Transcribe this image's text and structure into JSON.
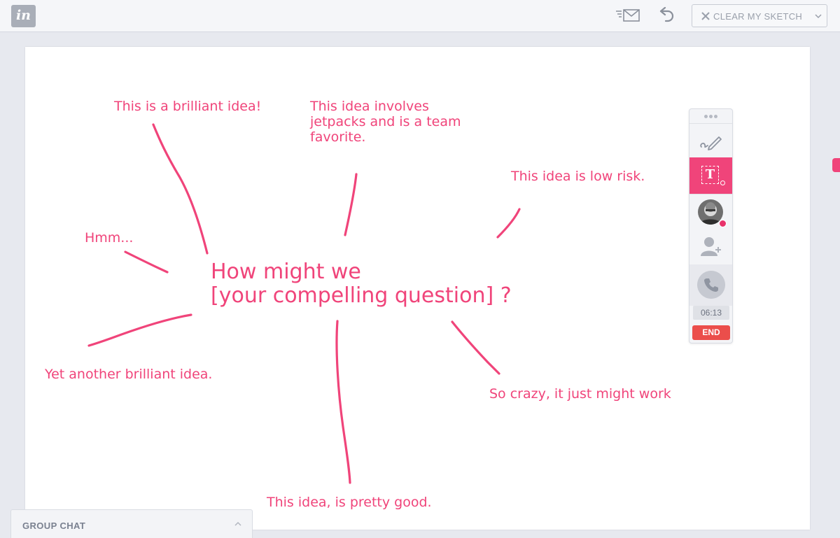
{
  "app": {
    "logo_text": "in"
  },
  "toolbar": {
    "clear_label": "CLEAR MY SKETCH",
    "icons": [
      "mail-icon",
      "undo-icon",
      "close-icon",
      "chevron-down-icon"
    ]
  },
  "canvas": {
    "question_line1": "How might we",
    "question_line2": "[your compelling question] ?",
    "notes": {
      "brilliant": "This is a brilliant idea!",
      "jetpacks_1": "This idea involves",
      "jetpacks_2": "jetpacks and is a team",
      "jetpacks_3": "favorite.",
      "low_risk": "This idea is low risk.",
      "hmm": "Hmm...",
      "another": "Yet another brilliant idea.",
      "crazy": "So crazy, it just might work",
      "pretty_good": "This idea, is pretty good."
    },
    "ink_color": "#f0447a"
  },
  "toolpanel": {
    "text_tool_glyph": "T",
    "timer": "06:13",
    "end_label": "END",
    "active_color": "#f0447a",
    "end_color": "#eb4e4b"
  },
  "group_chat": {
    "label": "GROUP CHAT"
  }
}
